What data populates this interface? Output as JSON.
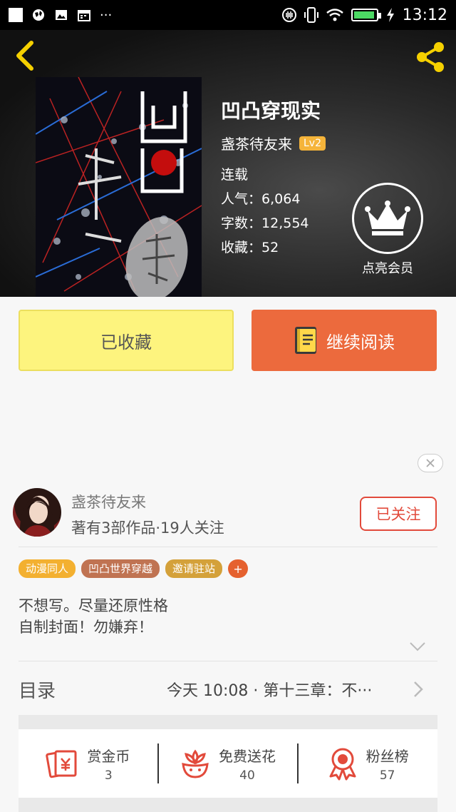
{
  "status_bar": {
    "time": "13:12",
    "overflow": "···"
  },
  "book": {
    "title": "凹凸穿现实",
    "author": "盏茶待友来",
    "level": "Lv2",
    "status": "连载",
    "popularity_label": "人气：",
    "popularity": "6,064",
    "words_label": "字数：",
    "words": "12,554",
    "favorites_label": "收藏：",
    "favorites": "52",
    "vip_label": "点亮会员"
  },
  "actions": {
    "collected_label": "已收藏",
    "continue_label": "继续阅读"
  },
  "author_card": {
    "name": "盏茶待友来",
    "stats": "著有3部作品·19人关注",
    "follow_label": "已关注"
  },
  "tags": [
    {
      "label": "动漫同人",
      "color": "#f3b030"
    },
    {
      "label": "凹凸世界穿越",
      "color": "#c07352"
    },
    {
      "label": "邀请驻站",
      "color": "#d4a13a"
    }
  ],
  "tag_add": "+",
  "description": {
    "line1": "不想写。尽量还原性格",
    "line2": "自制封面！勿嫌弃！"
  },
  "toc": {
    "label": "目录",
    "latest": "今天 10:08 · 第十三章：不···"
  },
  "stats": [
    {
      "label": "赏金币",
      "value": "3",
      "icon": "red-envelope-icon"
    },
    {
      "label": "免费送花",
      "value": "40",
      "icon": "flower-icon"
    },
    {
      "label": "粉丝榜",
      "value": "57",
      "icon": "ribbon-award-icon"
    }
  ],
  "colors": {
    "accent": "#ec6a3d",
    "collected": "#fdf47e",
    "follow": "#e24a3b",
    "icon_red": "#e24a3b"
  }
}
